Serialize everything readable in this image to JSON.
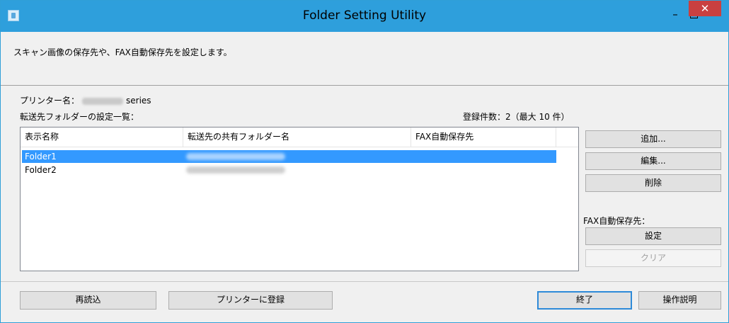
{
  "window": {
    "title": "Folder Setting Utility",
    "minimize_glyph": "–",
    "close_glyph": "✕"
  },
  "description": "スキャン画像の保存先や、FAX自動保存先を設定します。",
  "printer": {
    "label": "プリンター名：",
    "suffix": "series"
  },
  "folder_list": {
    "label": "転送先フォルダーの設定一覧：",
    "count_label": "登録件数：2（最大 10 件）",
    "columns": [
      "表示名称",
      "転送先の共有フォルダー名",
      "FAX自動保存先"
    ],
    "rows": [
      {
        "name": "Folder1",
        "selected": true
      },
      {
        "name": "Folder2",
        "selected": false
      }
    ]
  },
  "buttons": {
    "add": "追加...",
    "edit": "編集...",
    "delete": "削除",
    "fax_section_label": "FAX自動保存先：",
    "set": "設定",
    "clear": "クリア",
    "reload": "再読込",
    "register": "プリンターに登録",
    "exit": "終了",
    "help": "操作説明"
  },
  "colors": {
    "titlebar": "#2e9fdc",
    "selection": "#3399ff",
    "close_button": "#c94040"
  }
}
